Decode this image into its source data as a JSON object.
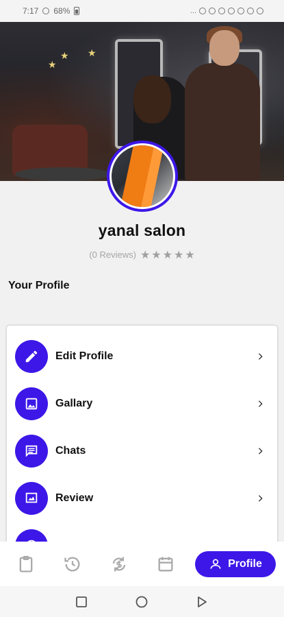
{
  "status_bar": {
    "time": "7:17",
    "battery": "68%",
    "more": "..."
  },
  "profile": {
    "name": "yanal salon",
    "reviews_count": "(0 Reviews)",
    "rating_stars": 5,
    "rating_value": 0
  },
  "section_title": "Your Profile",
  "menu": {
    "items": [
      {
        "label": "Edit Profile",
        "icon": "pencil-icon"
      },
      {
        "label": "Gallary",
        "icon": "image-icon"
      },
      {
        "label": "Chats",
        "icon": "chat-icon"
      },
      {
        "label": "Review",
        "icon": "review-icon"
      },
      {
        "label": "",
        "icon": "info-icon"
      }
    ]
  },
  "bottom_nav": {
    "items": [
      {
        "icon": "clipboard-icon"
      },
      {
        "icon": "history-icon"
      },
      {
        "icon": "sync-dollar-icon"
      },
      {
        "icon": "calendar-icon"
      }
    ],
    "active": {
      "label": "Profile",
      "icon": "person-icon"
    }
  },
  "colors": {
    "accent": "#3d17e8",
    "background": "#f1f1f1",
    "card": "#ffffff",
    "text": "#111111",
    "muted": "#a5a5a5"
  }
}
